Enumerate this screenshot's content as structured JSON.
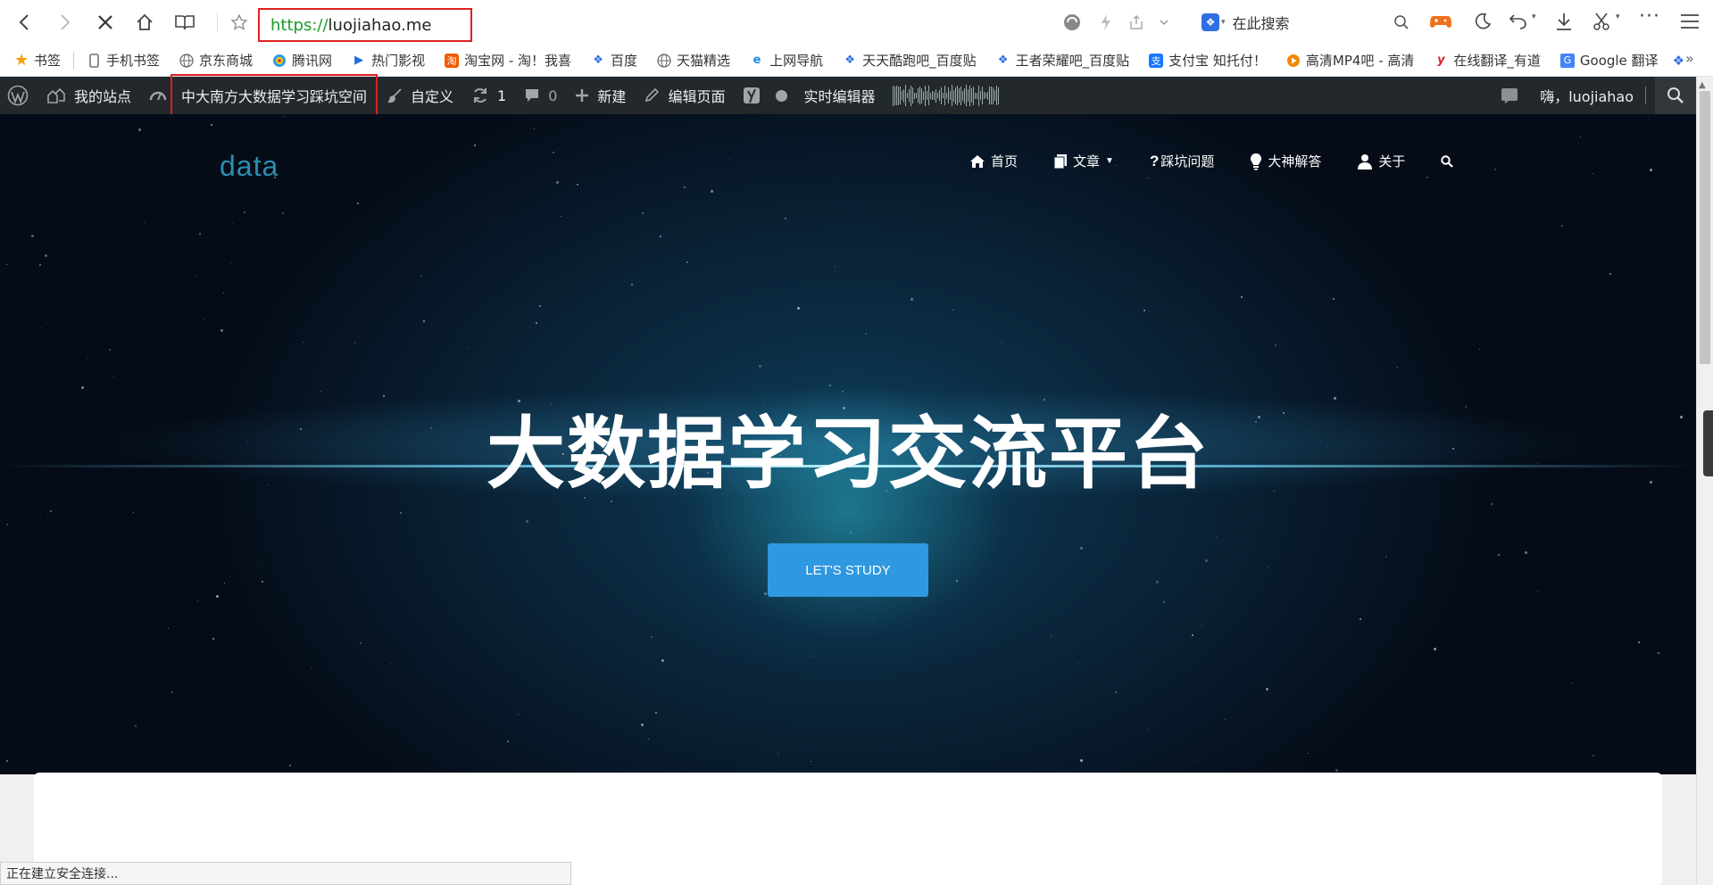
{
  "browser": {
    "url_scheme": "https://",
    "url_host": "luojiahao.me",
    "search_placeholder": "在此搜索"
  },
  "bookmarks": [
    {
      "label": "书签",
      "icon": "star-icon"
    },
    {
      "label": "手机书签",
      "icon": "phone-icon"
    },
    {
      "label": "京东商城",
      "icon": "globe-icon"
    },
    {
      "label": "腾讯网",
      "icon": "tencent-icon"
    },
    {
      "label": "热门影视",
      "icon": "play-icon"
    },
    {
      "label": "淘宝网 - 淘！我喜",
      "icon": "taobao-icon"
    },
    {
      "label": "百度",
      "icon": "baidu-paw-icon"
    },
    {
      "label": "天猫精选",
      "icon": "globe-icon"
    },
    {
      "label": "上网导航",
      "icon": "ie-icon"
    },
    {
      "label": "天天酷跑吧_百度贴",
      "icon": "baidu-paw-icon"
    },
    {
      "label": "王者荣耀吧_百度贴",
      "icon": "baidu-paw-icon"
    },
    {
      "label": "支付宝 知托付！",
      "icon": "alipay-icon"
    },
    {
      "label": "高清MP4吧 - 高清",
      "icon": "mp4-icon"
    },
    {
      "label": "在线翻译_有道",
      "icon": "youdao-icon"
    },
    {
      "label": "Google 翻译",
      "icon": "google-translate-icon"
    }
  ],
  "wp_admin": {
    "my_sites": "我的站点",
    "site_name": "中大南方大数据学习踩坑空间",
    "customize": "自定义",
    "updates_count": "1",
    "comments_count": "0",
    "new": "新建",
    "edit_page": "编辑页面",
    "live_editor": "实时编辑器",
    "greeting": "嗨，luojiahao"
  },
  "site": {
    "logo": "data",
    "menu": [
      {
        "label": "首页",
        "icon": "home-icon"
      },
      {
        "label": "文章",
        "icon": "pages-icon",
        "has_dropdown": true
      },
      {
        "label": "踩坑问题",
        "icon": "question-icon"
      },
      {
        "label": "大神解答",
        "icon": "lightbulb-icon"
      },
      {
        "label": "关于",
        "icon": "user-icon"
      }
    ],
    "hero_title": "大数据学习交流平台",
    "cta_label": "LET'S STUDY"
  },
  "status": {
    "text": "正在建立安全连接..."
  },
  "colors": {
    "url_scheme": "#1a9a2a",
    "highlight_border": "#e02020",
    "wp_bar": "#23282d",
    "cta": "#2e98e0",
    "logo": "#2a8fb0"
  }
}
